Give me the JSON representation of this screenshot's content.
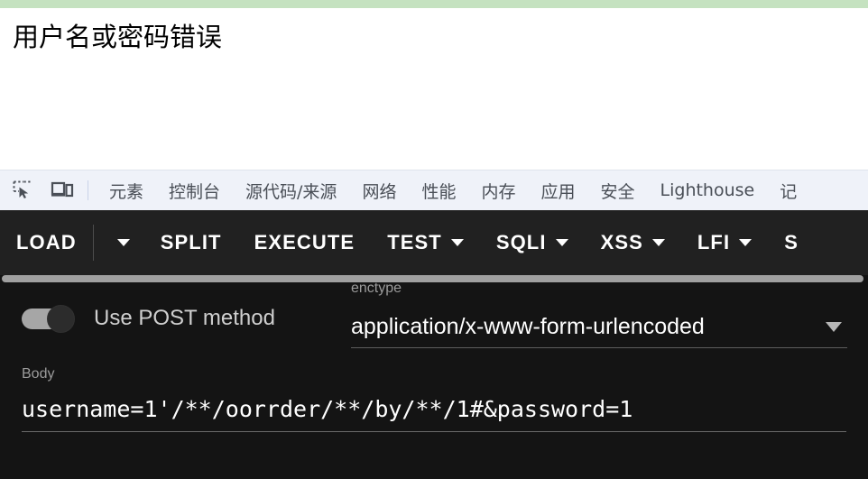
{
  "page": {
    "accent_green": "#c5e2c0",
    "message": "用户名或密码错误"
  },
  "devtools": {
    "inspect_icon": "inspect-element-icon",
    "device_icon": "device-toolbar-icon",
    "tabs": [
      {
        "label": "元素"
      },
      {
        "label": "控制台"
      },
      {
        "label": "源代码/来源"
      },
      {
        "label": "网络"
      },
      {
        "label": "性能"
      },
      {
        "label": "内存"
      },
      {
        "label": "应用"
      },
      {
        "label": "安全"
      },
      {
        "label": "Lighthouse"
      },
      {
        "label": "记"
      }
    ]
  },
  "toolbar": {
    "background": "#212121",
    "buttons": [
      {
        "label": "LOAD",
        "caret": false
      },
      {
        "label": "SPLIT",
        "caret": false
      },
      {
        "label": "EXECUTE",
        "caret": false
      },
      {
        "label": "TEST",
        "caret": true
      },
      {
        "label": "SQLI",
        "caret": true
      },
      {
        "label": "XSS",
        "caret": true
      },
      {
        "label": "LFI",
        "caret": true
      },
      {
        "label": "S",
        "caret": false
      }
    ],
    "load_dropdown_icon": "chevron-down-icon"
  },
  "form": {
    "post_toggle": {
      "label": "Use POST method",
      "state": "off"
    },
    "enctype": {
      "label": "enctype",
      "value": "application/x-www-form-urlencoded",
      "caret_icon": "chevron-down-icon"
    },
    "body": {
      "label": "Body",
      "value": "username=1'/**/oorrder/**/by/**/1#&password=1"
    }
  }
}
